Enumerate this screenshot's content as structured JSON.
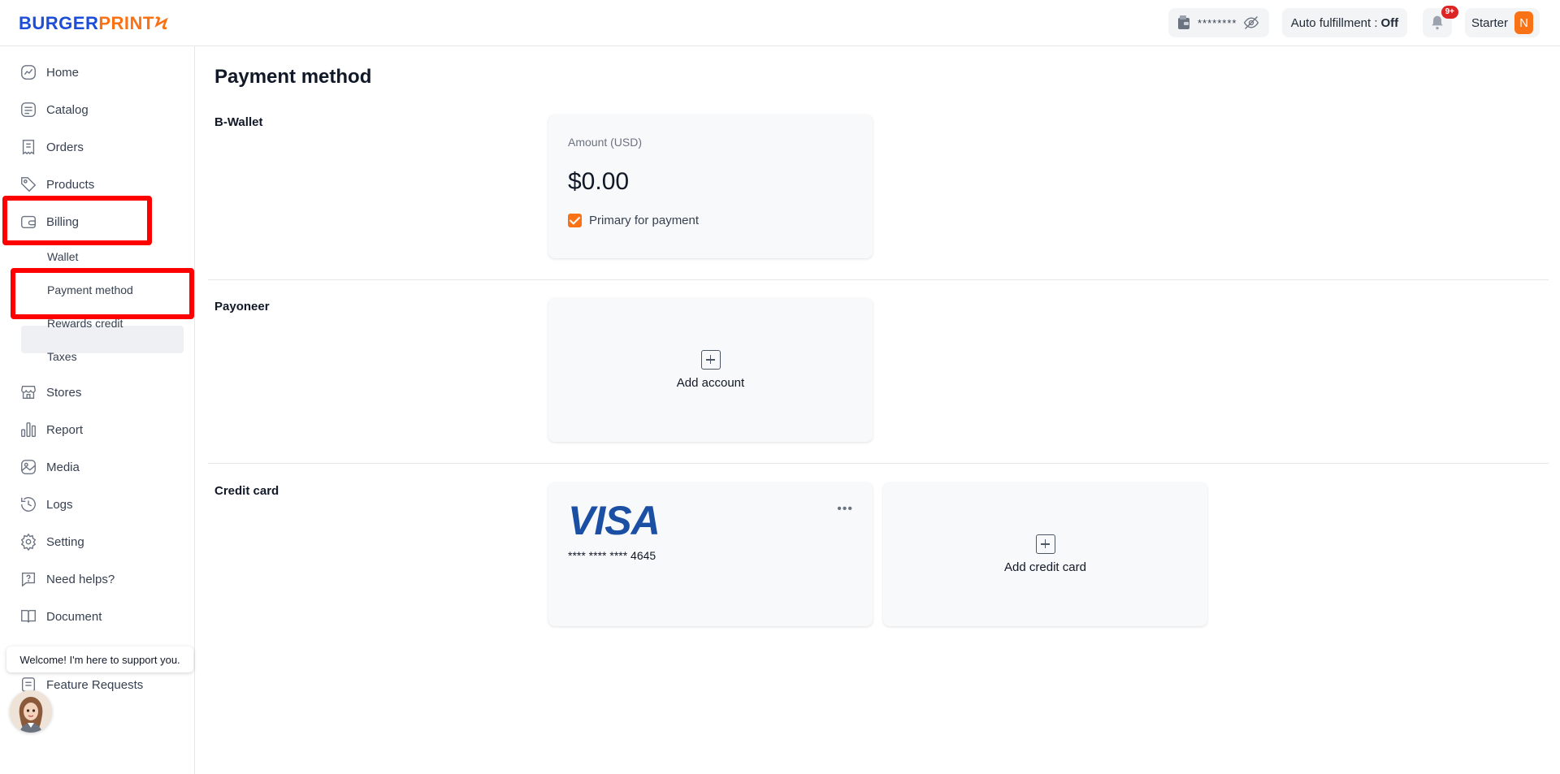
{
  "header": {
    "logo_burger": "BURGER",
    "logo_print": "PRINT",
    "logo_bolt": "Ϟ",
    "balance_mask": "********",
    "auto_fulfillment_label": "Auto fulfillment :",
    "auto_fulfillment_value": "Off",
    "notification_badge": "9+",
    "plan_label": "Starter",
    "avatar_initial": "N"
  },
  "sidebar": {
    "items": [
      {
        "label": "Home",
        "icon": "home-icon"
      },
      {
        "label": "Catalog",
        "icon": "catalog-icon"
      },
      {
        "label": "Orders",
        "icon": "orders-icon"
      },
      {
        "label": "Products",
        "icon": "tag-icon"
      },
      {
        "label": "Billing",
        "icon": "wallet-icon"
      },
      {
        "label": "Stores",
        "icon": "store-icon"
      },
      {
        "label": "Report",
        "icon": "chart-icon"
      },
      {
        "label": "Media",
        "icon": "image-icon"
      },
      {
        "label": "Logs",
        "icon": "history-icon"
      },
      {
        "label": "Setting",
        "icon": "gear-icon"
      },
      {
        "label": "Need helps?",
        "icon": "help-icon"
      },
      {
        "label": "Document",
        "icon": "book-icon"
      },
      {
        "label": "Feature Requests",
        "icon": "list-icon"
      }
    ],
    "billing_sub": [
      {
        "label": "Wallet"
      },
      {
        "label": "Payment method",
        "active": true
      },
      {
        "label": "Rewards credit"
      },
      {
        "label": "Taxes"
      }
    ],
    "welcome_message": "Welcome! I'm here to support you."
  },
  "main": {
    "title": "Payment method",
    "bwallet": {
      "label": "B-Wallet",
      "amount_label": "Amount (USD)",
      "amount_value": "$0.00",
      "primary_label": "Primary for payment",
      "primary_checked": true
    },
    "payoneer": {
      "label": "Payoneer",
      "add_label": "Add account"
    },
    "credit_card": {
      "label": "Credit card",
      "brand": "VISA",
      "number": "**** **** **** 4645",
      "more": "•••",
      "add_label": "Add credit card"
    }
  },
  "colors": {
    "accent": "#f97316",
    "brand_blue": "#1d4ed8",
    "highlight": "#ff0000"
  }
}
